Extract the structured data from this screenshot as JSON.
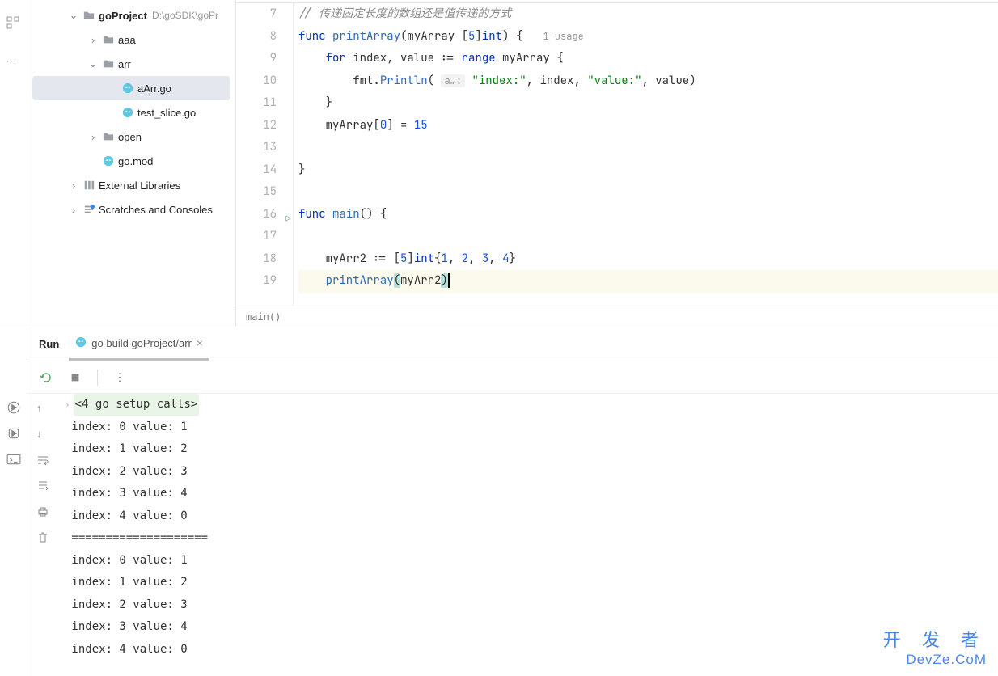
{
  "project_tree": {
    "root": {
      "name": "goProject",
      "path": "D:\\goSDK\\goPr"
    },
    "items": [
      {
        "name": "aaa",
        "type": "folder",
        "depth": 1,
        "expanded": false
      },
      {
        "name": "arr",
        "type": "folder",
        "depth": 1,
        "expanded": true
      },
      {
        "name": "aArr.go",
        "type": "go",
        "depth": 2,
        "selected": true
      },
      {
        "name": "test_slice.go",
        "type": "go",
        "depth": 2
      },
      {
        "name": "open",
        "type": "folder",
        "depth": 1,
        "expanded": false
      },
      {
        "name": "go.mod",
        "type": "go",
        "depth": 1
      }
    ],
    "external": "External Libraries",
    "scratches": "Scratches and Consoles"
  },
  "editor": {
    "lines": [
      {
        "n": 7,
        "html": "<span class='c-comment'>// 传递固定长度的数组还是值传递的方式</span>"
      },
      {
        "n": 8,
        "html": "<span class='c-key'>func</span> <span class='c-func'>printArray</span>(myArray [<span class='c-num'>5</span>]<span class='c-key'>int</span>) {   <span class='c-usage'>1 usage</span>"
      },
      {
        "n": 9,
        "html": "    <span class='c-key'>for</span> index, value := <span class='c-key'>range</span> myArray {"
      },
      {
        "n": 10,
        "html": "        fmt.<span class='c-func'>Println</span>( <span class='c-hint'>a…:</span> <span class='c-str'>\"index:\"</span>, index, <span class='c-str'>\"value:\"</span>, value)"
      },
      {
        "n": 11,
        "html": "    }"
      },
      {
        "n": 12,
        "html": "    myArray[<span class='c-num'>0</span>] = <span class='c-num'>15</span>"
      },
      {
        "n": 13,
        "html": ""
      },
      {
        "n": 14,
        "html": "}"
      },
      {
        "n": 15,
        "html": ""
      },
      {
        "n": 16,
        "html": "<span class='c-key'>func</span> <span class='c-func'>main</span>() {",
        "run": true
      },
      {
        "n": 17,
        "html": ""
      },
      {
        "n": 18,
        "html": "    myArr2 := [<span class='c-num'>5</span>]<span class='c-key'>int</span>{<span class='c-num'>1</span>, <span class='c-num'>2</span>, <span class='c-num'>3</span>, <span class='c-num'>4</span>}"
      },
      {
        "n": 19,
        "html": "    <span class='c-func'>printArray</span><span class='hl-paren'>(</span>myArr2<span class='hl-paren'>)</span><span class='cursor'></span>",
        "current": true
      }
    ],
    "breadcrumb": "main()"
  },
  "run_panel": {
    "title": "Run",
    "tab": "go build goProject/arr",
    "folded": "<4 go setup calls>",
    "output": [
      "index: 0 value: 1",
      "index: 1 value: 2",
      "index: 2 value: 3",
      "index: 3 value: 4",
      "index: 4 value: 0",
      "====================",
      "index: 0 value: 1",
      "index: 1 value: 2",
      "index: 2 value: 3",
      "index: 3 value: 4",
      "index: 4 value: 0"
    ]
  },
  "watermark": {
    "l1": "开 发 者",
    "l2": "DevZe.CoM"
  }
}
